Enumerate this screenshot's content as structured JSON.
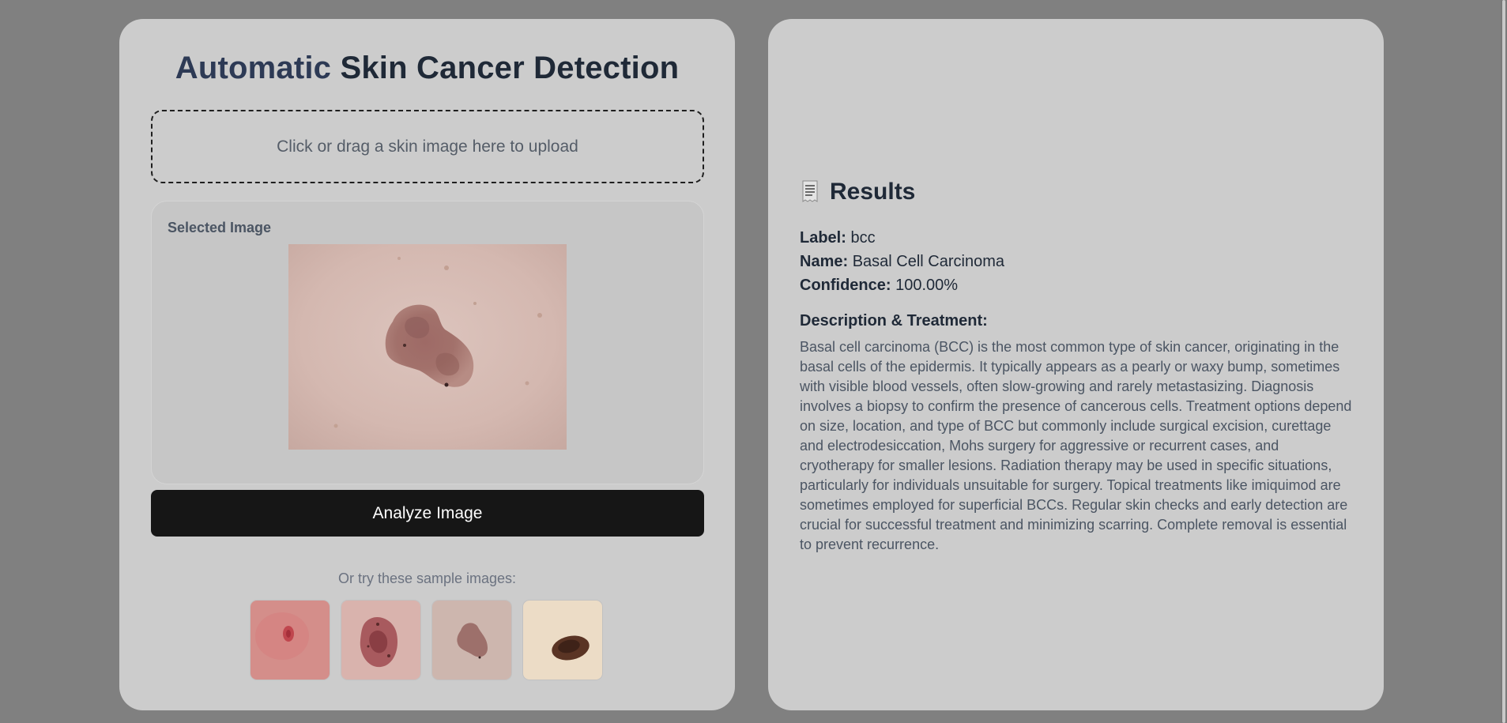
{
  "upload": {
    "title_part1": "Automatic",
    "title_part2": "Skin Cancer Detection",
    "dropzone_text": "Click or drag a skin image here to upload",
    "preview_label": "Selected Image",
    "analyze_button": "Analyze Image",
    "samples_label": "Or try these sample images:",
    "samples": [
      {
        "icon": "sample-lesion-1"
      },
      {
        "icon": "sample-lesion-2"
      },
      {
        "icon": "sample-lesion-3"
      },
      {
        "icon": "sample-lesion-4"
      }
    ]
  },
  "results": {
    "icon": "receipt-icon",
    "title": "Results",
    "label_key": "Label:",
    "label_value": "bcc",
    "name_key": "Name:",
    "name_value": "Basal Cell Carcinoma",
    "confidence_key": "Confidence:",
    "confidence_value": "100.00%",
    "description_title": "Description & Treatment:",
    "description": "Basal cell carcinoma (BCC) is the most common type of skin cancer, originating in the basal cells of the epidermis. It typically appears as a pearly or waxy bump, sometimes with visible blood vessels, often slow-growing and rarely metastasizing. Diagnosis involves a biopsy to confirm the presence of cancerous cells. Treatment options depend on size, location, and type of BCC but commonly include surgical excision, curettage and electrodesiccation, Mohs surgery for aggressive or recurrent cases, and cryotherapy for smaller lesions. Radiation therapy may be used in specific situations, particularly for individuals unsuitable for surgery. Topical treatments like imiquimod are sometimes employed for superficial BCCs. Regular skin checks and early detection are crucial for successful treatment and minimizing scarring. Complete removal is essential to prevent recurrence."
  },
  "colors": {
    "background": "#808080",
    "card": "#cccccc",
    "button": "#161616",
    "heading": "#1f2937",
    "muted": "#4b5563"
  }
}
